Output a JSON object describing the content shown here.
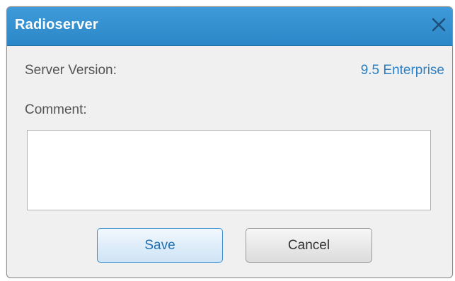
{
  "window": {
    "title": "Radioserver",
    "close_icon": "close-icon"
  },
  "form": {
    "server_version_label": "Server Version:",
    "server_version_value": "9.5 Enterprise",
    "comment_label": "Comment:",
    "comment_value": ""
  },
  "buttons": {
    "save_label": "Save",
    "cancel_label": "Cancel"
  },
  "colors": {
    "titlebar": "#2c87c8",
    "version_value": "#2a7fc4",
    "save_border": "#3a8fd0"
  }
}
